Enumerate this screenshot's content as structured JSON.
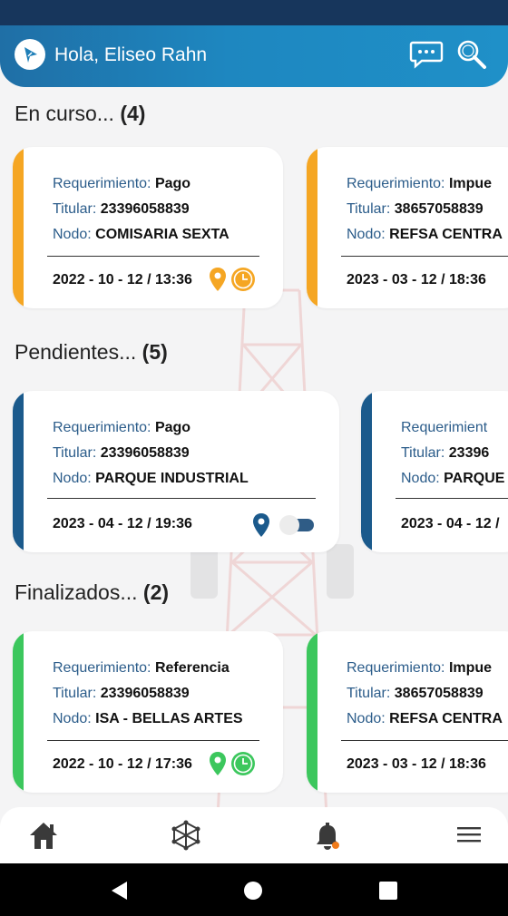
{
  "header": {
    "greeting": "Hola, Eliseo Rahn",
    "icons": [
      "logo-icon",
      "chat-icon",
      "search-icon"
    ]
  },
  "colors": {
    "header_gradient_start": "#1f6fa6",
    "header_gradient_end": "#1f90c8",
    "in_progress": "#f5a623",
    "pending": "#1b5a8c",
    "finished": "#3cc75d",
    "label": "#2b5c8a"
  },
  "sections": {
    "en_curso": {
      "title": "En curso...",
      "count": "(4)",
      "cards": [
        {
          "req_label": "Requerimiento:",
          "req_value": "Pago",
          "titular_label": "Titular:",
          "titular_value": "23396058839",
          "nodo_label": "Nodo:",
          "nodo_value": "COMISARIA SEXTA",
          "date": "2022 - 10 - 12 / 13:36"
        },
        {
          "req_label": "Requerimiento:",
          "req_value": "Impue",
          "titular_label": "Titular:",
          "titular_value": "38657058839",
          "nodo_label": "Nodo:",
          "nodo_value": "REFSA CENTRA",
          "date": "2023 - 03 - 12 / 18:36"
        }
      ]
    },
    "pendientes": {
      "title": "Pendientes...",
      "count": "(5)",
      "cards": [
        {
          "req_label": "Requerimiento:",
          "req_value": "Pago",
          "titular_label": "Titular:",
          "titular_value": "23396058839",
          "nodo_label": "Nodo:",
          "nodo_value": "PARQUE INDUSTRIAL",
          "date": "2023 - 04 - 12 / 19:36"
        },
        {
          "req_label": "Requerimient",
          "req_value": "",
          "titular_label": "Titular:",
          "titular_value": "23396",
          "nodo_label": "Nodo:",
          "nodo_value": "PARQUE",
          "date": "2023 - 04 - 12 /"
        }
      ]
    },
    "finalizados": {
      "title": "Finalizados...",
      "count": "(2)",
      "cards": [
        {
          "req_label": "Requerimiento:",
          "req_value": "Referencia",
          "titular_label": "Titular:",
          "titular_value": "23396058839",
          "nodo_label": "Nodo:",
          "nodo_value": "ISA - BELLAS ARTES",
          "date": "2022 - 10 - 12 / 17:36"
        },
        {
          "req_label": "Requerimiento:",
          "req_value": "Impue",
          "titular_label": "Titular:",
          "titular_value": "38657058839",
          "nodo_label": "Nodo:",
          "nodo_value": "REFSA CENTRA",
          "date": "2023 - 03 - 12 / 18:36"
        }
      ]
    }
  },
  "bottom_nav": {
    "items": [
      "home-icon",
      "network-icon",
      "notifications-icon",
      "menu-icon"
    ],
    "notification_dot": true
  },
  "system_nav": {
    "items": [
      "back-icon",
      "home-circle-icon",
      "recents-icon"
    ]
  }
}
